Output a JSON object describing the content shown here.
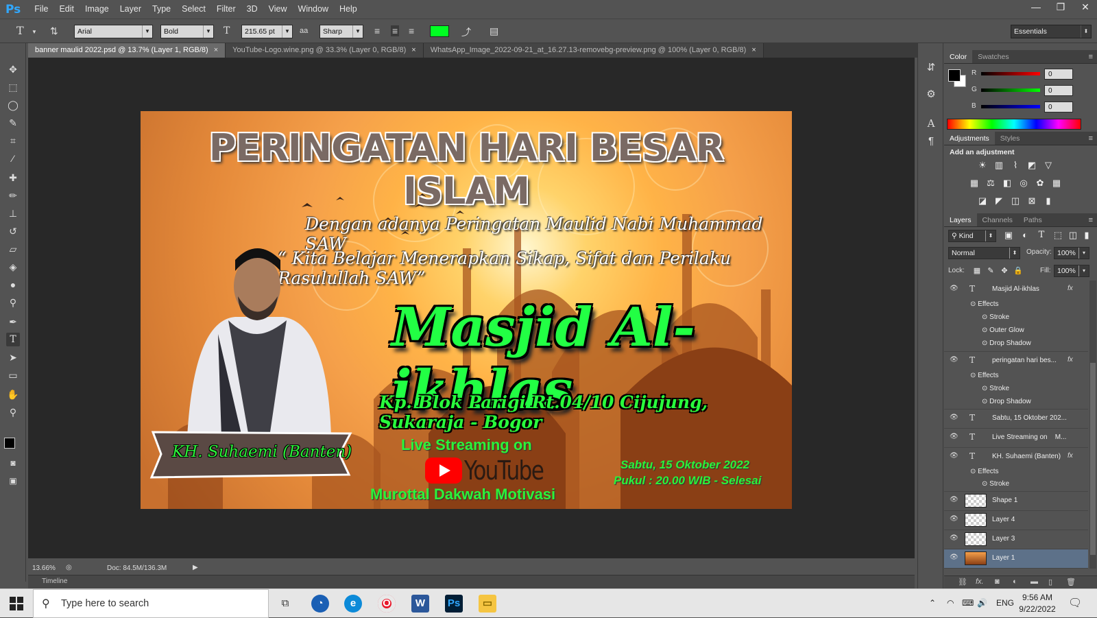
{
  "app": {
    "logo": "Ps"
  },
  "menu": [
    "File",
    "Edit",
    "Image",
    "Layer",
    "Type",
    "Select",
    "Filter",
    "3D",
    "View",
    "Window",
    "Help"
  ],
  "window_controls": {
    "minimize": "—",
    "restore": "❐",
    "close": "✕"
  },
  "options": {
    "font_family": "Arial",
    "font_style": "Bold",
    "font_size": "215.65 pt",
    "antialias_icon": "aa",
    "antialias": "Sharp",
    "text_color": "#00ff22",
    "workspace": "Essentials"
  },
  "tabs": [
    {
      "label": "banner maulid 2022.psd @ 13.7% (Layer 1, RGB/8)",
      "close": "×"
    },
    {
      "label": "YouTube-Logo.wine.png @ 33.3% (Layer 0, RGB/8)",
      "close": "×"
    },
    {
      "label": "WhatsApp_Image_2022-09-21_at_16.27.13-removebg-preview.png @ 100% (Layer 0, RGB/8)",
      "close": "×"
    }
  ],
  "document": {
    "title": "PERINGATAN HARI BESAR ISLAM",
    "line1": "Dengan adanya Peringatan Maulid Nabi Muhammad SAW",
    "line2": "“ Kita Belajar Menerapkan Sikap, Sifat dan Perilaku Rasulullah SAW”",
    "masjid": "Masjid Al-ikhlas",
    "address": "Kp. Blok Parigi Rt.04/10 Cijujung, Sukaraja - Bogor",
    "live": "Live Streaming on",
    "youtube": "YouTube",
    "murottal": "Murottal Dakwah Motivasi",
    "date": "Sabtu, 15 Oktober 2022",
    "time": "Pukul : 20.00 WIB - Selesai",
    "speaker": "KH. Suhaemi (Banten)"
  },
  "status": {
    "zoom": "13.66%",
    "doc": "Doc: 84.5M/136.3M"
  },
  "timeline": {
    "label": "Timeline"
  },
  "color_panel": {
    "tabs": [
      "Color",
      "Swatches"
    ],
    "r_label": "R",
    "g_label": "G",
    "b_label": "B",
    "r": "0",
    "g": "0",
    "b": "0"
  },
  "adjustments_panel": {
    "tabs": [
      "Adjustments",
      "Styles"
    ],
    "heading": "Add an adjustment"
  },
  "layers_panel": {
    "tabs": [
      "Layers",
      "Channels",
      "Paths"
    ],
    "kind": "Kind",
    "blend": "Normal",
    "opacity_label": "Opacity:",
    "opacity": "100%",
    "lock_label": "Lock:",
    "fill_label": "Fill:",
    "fill": "100%",
    "effects_label": "Effects",
    "layers": [
      {
        "name": "Masjid Al-ikhlas",
        "effects": [
          "Stroke",
          "Outer Glow",
          "Drop Shadow"
        ]
      },
      {
        "name": "peringatan hari bes...",
        "effects": [
          "Stroke",
          "Drop Shadow"
        ]
      },
      {
        "name": "Sabtu, 15 Oktober 202..."
      },
      {
        "name": "Live Streaming on    M..."
      },
      {
        "name": "KH. Suhaemi (Banten)",
        "effects": [
          "Stroke"
        ]
      },
      {
        "name": "Shape 1"
      },
      {
        "name": "Layer 4"
      },
      {
        "name": "Layer 3"
      },
      {
        "name": "Layer 1"
      }
    ]
  },
  "taskbar": {
    "search_placeholder": "Type here to search",
    "lang": "ENG",
    "time": "9:56 AM",
    "date": "9/22/2022"
  }
}
